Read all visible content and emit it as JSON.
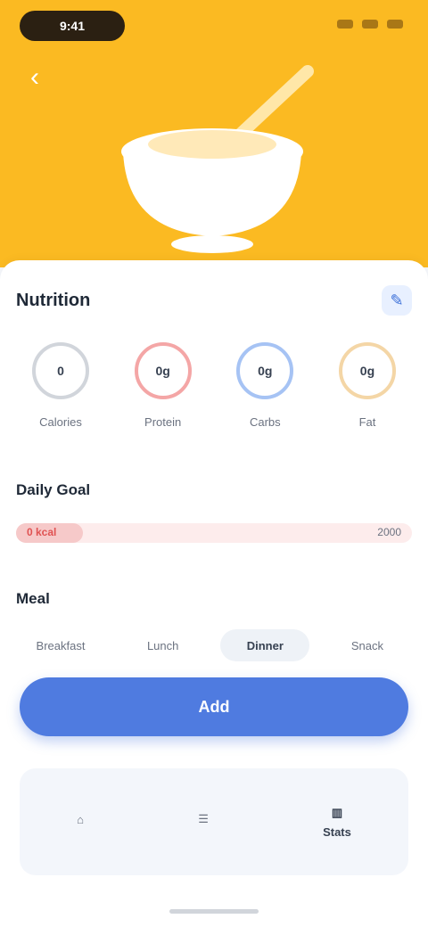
{
  "status_bar": {
    "time": "9:41"
  },
  "hero": {
    "back_icon": "chevron-left-icon",
    "illustration": "bowl-icon"
  },
  "nutrition": {
    "title": "Nutrition",
    "edit_icon": "edit-icon",
    "items": [
      {
        "value": "0",
        "label": "Calories",
        "ring_color": "#d1d5db"
      },
      {
        "value": "0g",
        "label": "Protein",
        "ring_color": "#f4a6a6"
      },
      {
        "value": "0g",
        "label": "Carbs",
        "ring_color": "#a6c3f4"
      },
      {
        "value": "0g",
        "label": "Fat",
        "ring_color": "#f4d6a6"
      }
    ]
  },
  "range": {
    "title": "Daily Goal",
    "left_label": "0 kcal",
    "right_label": "2000",
    "progress": 0.17
  },
  "meal": {
    "title": "Meal",
    "options": [
      "Breakfast",
      "Lunch",
      "Dinner",
      "Snack"
    ],
    "selected_index": 2
  },
  "primary_button": {
    "label": "Add"
  },
  "bottom_panel": {
    "items": [
      {
        "icon": "home-icon",
        "label": ""
      },
      {
        "icon": "list-icon",
        "label": ""
      },
      {
        "icon": "chart-icon",
        "label": "Stats"
      }
    ],
    "active_index": 2
  },
  "colors": {
    "hero_bg": "#fbba22",
    "primary": "#4f7be0"
  }
}
